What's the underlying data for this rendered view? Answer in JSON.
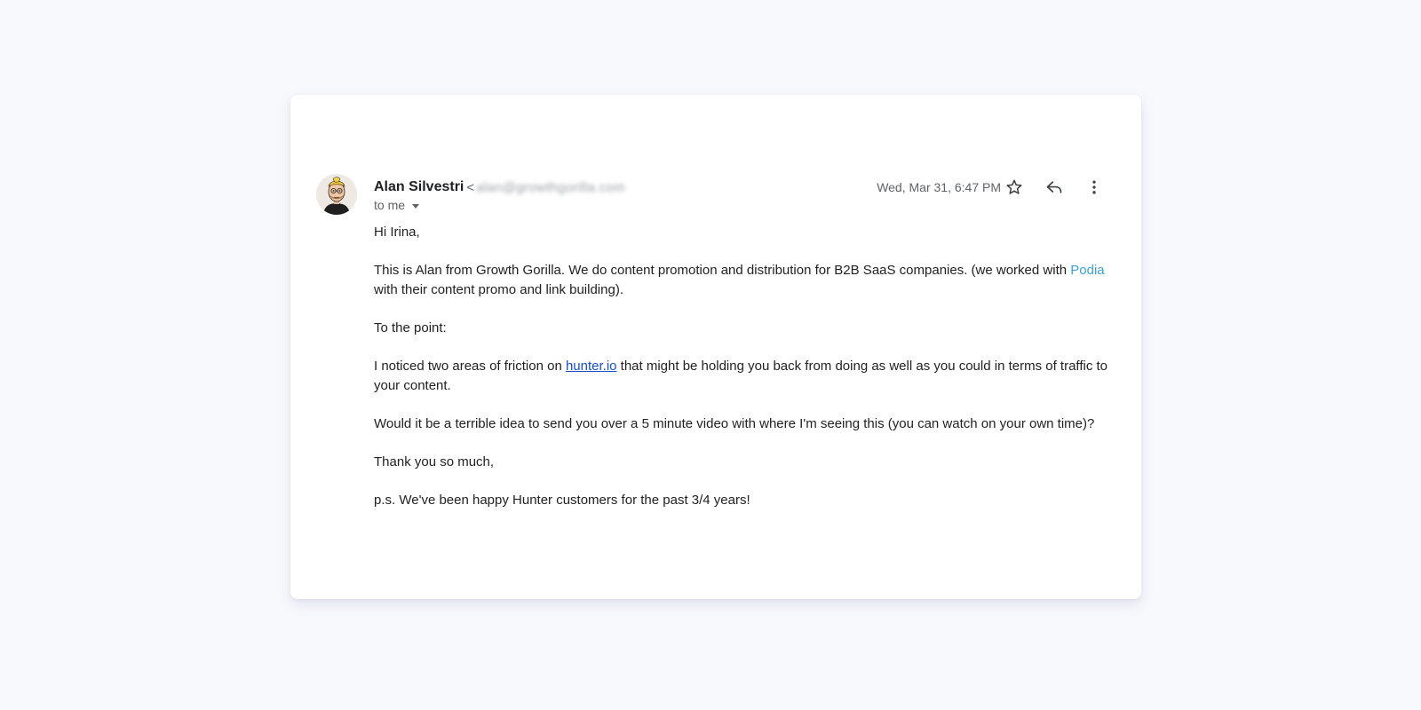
{
  "email": {
    "sender": {
      "name": "Alan Silvestri",
      "email_open_bracket": "<",
      "email_redacted": "alan@growthgorilla.com"
    },
    "recipient": "to me",
    "date": "Wed, Mar 31, 6:47 PM",
    "actions": {
      "star_icon": "star-icon",
      "reply_icon": "reply-icon",
      "more_icon": "more-vert-icon"
    },
    "body": {
      "greeting": "Hi Irina,",
      "p1_before": "This is Alan from Growth Gorilla. We do content promotion and distribution for B2B SaaS companies. (we worked with ",
      "p1_link": "Podia",
      "p1_after": " with their content promo and link building).",
      "p2": "To the point:",
      "p3_before": "I noticed two areas of friction on ",
      "p3_link": "hunter.io",
      "p3_after": " that might be holding you back from doing as well as you could in terms of traffic to your content.",
      "p4": "Would it be a terrible idea to send you over a 5 minute video with where I'm seeing this (you can watch on your own time)?",
      "p5": "Thank you so much,",
      "p6": "p.s. We've been happy Hunter customers for the past 3/4 years!"
    }
  },
  "colors": {
    "podia_link": "#3fa2d3",
    "hunter_link": "#1a4fc4",
    "background": "#f8f9fd"
  }
}
